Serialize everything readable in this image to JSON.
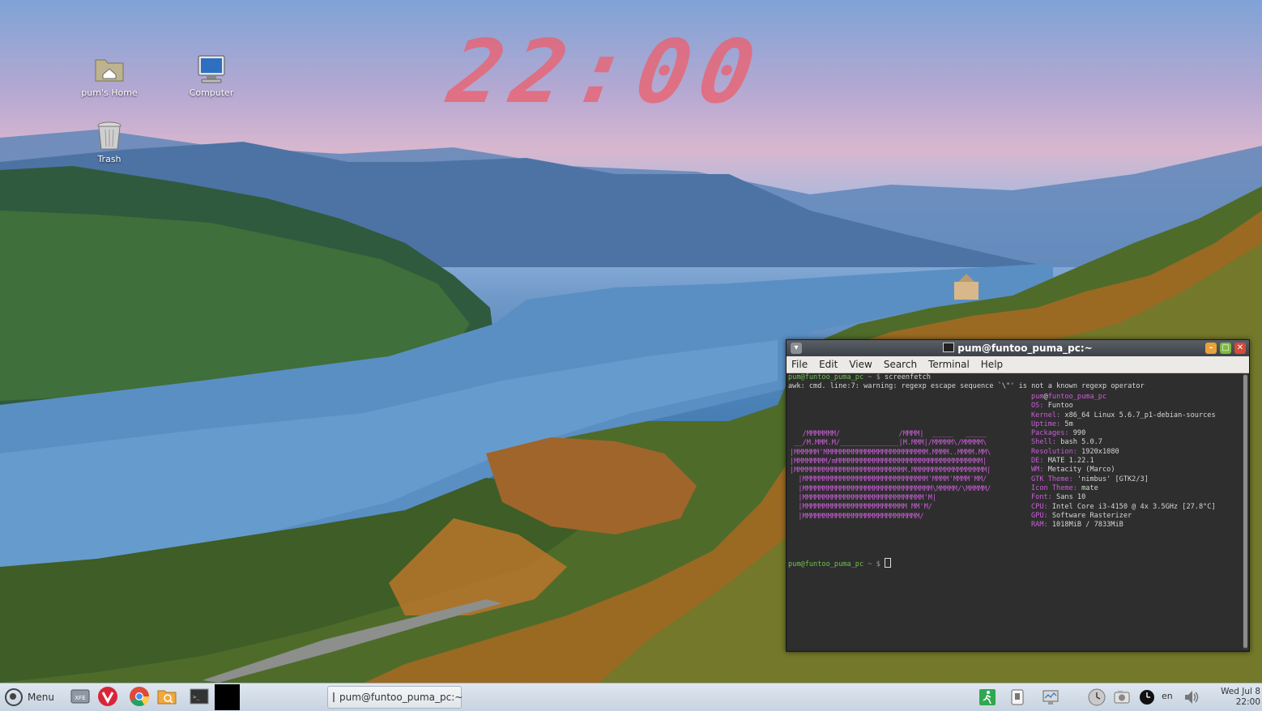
{
  "desktop": {
    "icons": [
      {
        "label": "pum's Home",
        "icon": "home-folder-icon"
      },
      {
        "label": "Computer",
        "icon": "computer-icon"
      },
      {
        "label": "Trash",
        "icon": "trash-icon"
      }
    ],
    "clock": "22:00"
  },
  "terminal": {
    "title": "pum@funtoo_puma_pc:~",
    "menu": [
      "File",
      "Edit",
      "View",
      "Search",
      "Terminal",
      "Help"
    ],
    "prompt_user": "pum@funtoo_puma_pc",
    "prompt_sep": " ~ $ ",
    "command": "screenfetch",
    "warning": "awk: cmd. line:7: warning: regexp escape sequence `\\\"' is not a known regexp operator",
    "logo_lines": [
      "   /MMMMMMM/              /MMMM|  _____   _____",
      " __/M.MMM.M/______________|M.MMM|/MMMMM\\/MMMMM\\",
      "|MMMMMM'MMMMMMMMMMMMMMMMMMMMMMMMM.MMMM..MMMM.MM\\",
      "|MMMMMMMM/mMMMMMMMMMMMMMMMMMMMMMMMMMMMMMMMMMMM|",
      "|MMMMMMMMMMMMMMMMMMMMMMMMMMM.MMMMMMMMMMMMMMMMMM|",
      "  |MMMMMMMMMMMMMMMMMMMMMMMMMMMMMM'MMMM'MMMM'MM/",
      "  |MMMMMMMMMMMMMMMMMMMMMMMMMMMMMMM\\MMMMM/\\MMMMM/",
      "  |MMMMMMMMMMMMMMMMMMMMMMMMMMMMM'M|",
      "  |MMMMMMMMMMMMMMMMMMMMMMMMM MM'M/",
      "  |MMMMMMMMMMMMMMMMMMMMMMMMMMMM/"
    ],
    "info_header_user": "pum",
    "info_header_at": "@",
    "info_header_host": "funtoo_puma_pc",
    "info": [
      {
        "key": "OS:",
        "value": " Funtoo"
      },
      {
        "key": "Kernel:",
        "value": " x86_64 Linux 5.6.7_p1-debian-sources"
      },
      {
        "key": "Uptime:",
        "value": " 5m"
      },
      {
        "key": "Packages:",
        "value": " 990"
      },
      {
        "key": "Shell:",
        "value": " bash 5.0.7"
      },
      {
        "key": "Resolution:",
        "value": " 1920x1080"
      },
      {
        "key": "DE:",
        "value": " MATE 1.22.1"
      },
      {
        "key": "WM:",
        "value": " Metacity (Marco)"
      },
      {
        "key": "GTK Theme:",
        "value": " 'nimbus' [GTK2/3]"
      },
      {
        "key": "Icon Theme:",
        "value": " mate"
      },
      {
        "key": "Font:",
        "value": " Sans 10"
      },
      {
        "key": "CPU:",
        "value": " Intel Core i3-4150 @ 4x 3.5GHz [27.8°C]"
      },
      {
        "key": "GPU:",
        "value": " Software Rasterizer"
      },
      {
        "key": "RAM:",
        "value": " 1018MiB / 7833MiB"
      }
    ]
  },
  "taskbar": {
    "menu_label": "Menu",
    "window_button": "pum@funtoo_puma_pc:~",
    "lang": "en",
    "date": "Wed Jul  8",
    "time": "22:00"
  },
  "colors": {
    "prompt_green": "#6ec14c",
    "screenfetch_magenta": "#c95fd6",
    "clock_red": "#ec606e"
  }
}
